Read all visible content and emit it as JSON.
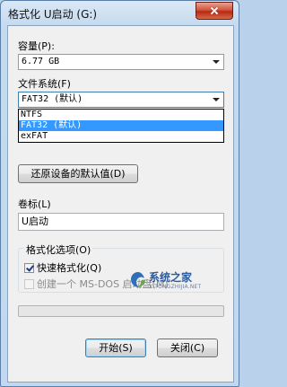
{
  "window": {
    "title": "格式化 U启动 (G:)"
  },
  "capacity": {
    "label": "容量(P):",
    "value": "6.77 GB"
  },
  "filesystem": {
    "label": "文件系统(F)",
    "value": "FAT32 (默认)",
    "options": [
      "NTFS",
      "FAT32 (默认)",
      "exFAT"
    ],
    "selected_index": 1
  },
  "restore_button": "还原设备的默认值(D)",
  "volume_label": {
    "label": "卷标(L)",
    "value": "U启动"
  },
  "format_options": {
    "title": "格式化选项(O)",
    "quick_format": {
      "label": "快速格式化(Q)",
      "checked": true
    },
    "msdos_disk": {
      "label": "创建一个 MS-DOS 启动盘(M)",
      "checked": false,
      "enabled": false
    }
  },
  "progress": {
    "value": 0
  },
  "buttons": {
    "start": "开始(S)",
    "close": "关闭(C)"
  },
  "watermark": {
    "name": "系统之家",
    "url": "XITONGZHIJIA.NET"
  },
  "icons": {
    "close": "close-icon",
    "dropdown": "chevron-down-icon",
    "logo": "xitongzhijia-logo"
  },
  "colors": {
    "selection": "#3399ff",
    "progress": "#06b025",
    "close_button": "#c7432b"
  }
}
